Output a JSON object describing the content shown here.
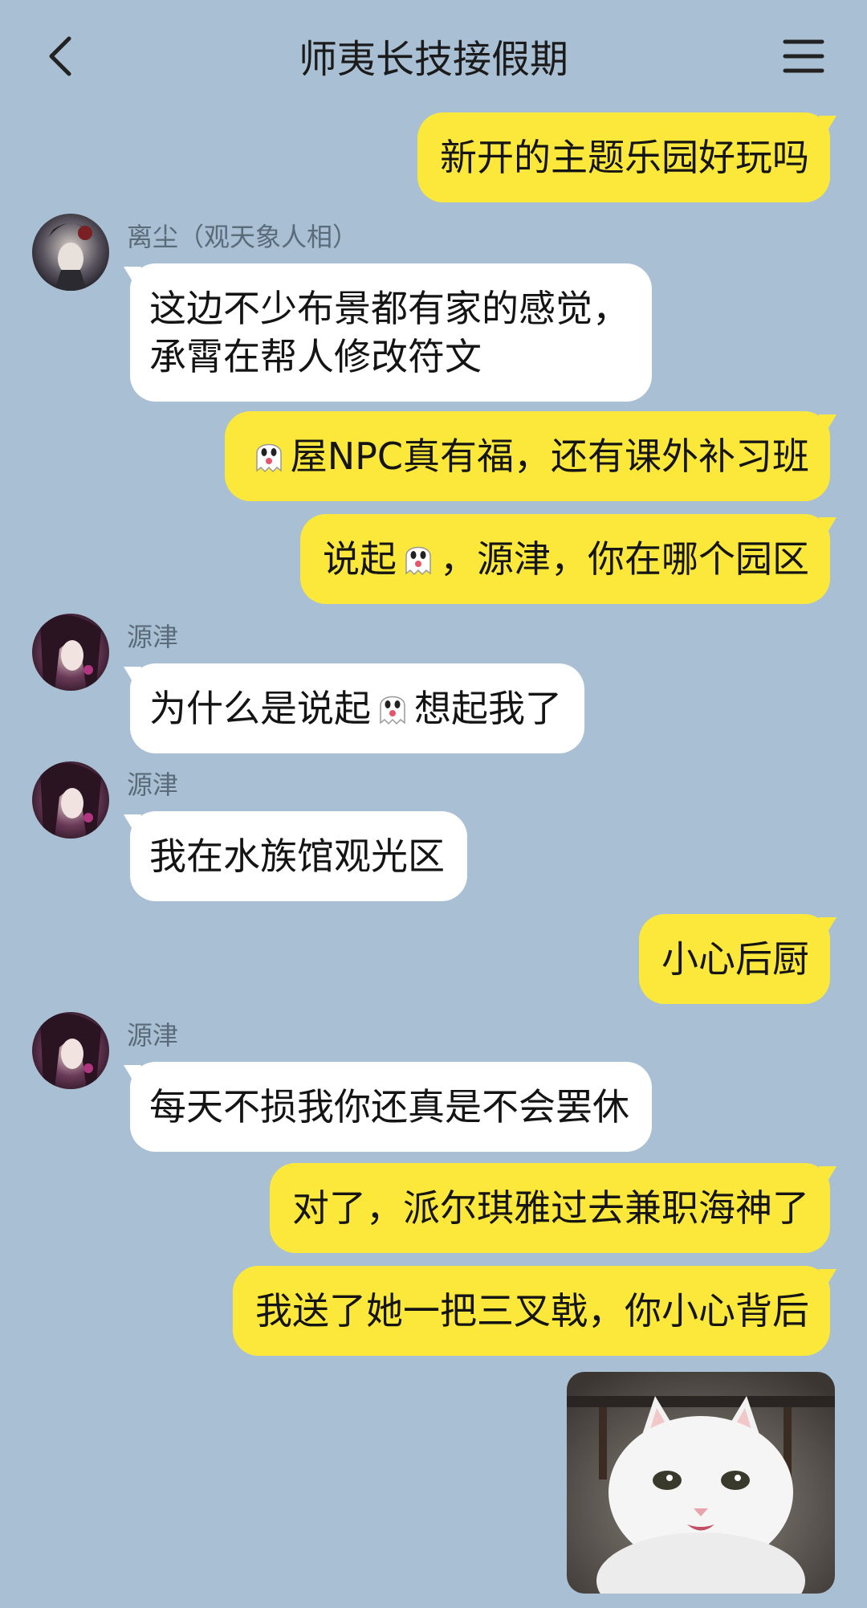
{
  "header": {
    "title": "师夷长技接假期",
    "back_icon": "chevron-left-icon",
    "menu_icon": "hamburger-menu-icon"
  },
  "colors": {
    "background": "#a9bfd3",
    "outgoing_bubble": "#fce83b",
    "incoming_bubble": "#ffffff"
  },
  "messages": [
    {
      "direction": "out",
      "text": "新开的主题乐园好玩吗"
    },
    {
      "direction": "in",
      "sender": "离尘（观天象人相）",
      "lines": [
        "这边不少布景都有家的感觉，",
        "承霄在帮人修改符文"
      ]
    },
    {
      "direction": "out",
      "parts": [
        "",
        "屋NPC真有福，还有课外补习班"
      ]
    },
    {
      "direction": "out",
      "parts": [
        "说起",
        "，源津，你在哪个园区"
      ]
    },
    {
      "direction": "in",
      "sender": "源津",
      "parts": [
        "为什么是说起",
        "想起我了"
      ]
    },
    {
      "direction": "in",
      "sender": "源津",
      "text": "我在水族馆观光区"
    },
    {
      "direction": "out",
      "text": "小心后厨"
    },
    {
      "direction": "in",
      "sender": "源津",
      "text": "每天不损我你还真是不会罢休"
    },
    {
      "direction": "out",
      "text": "对了，派尔琪雅过去兼职海神了"
    },
    {
      "direction": "out",
      "text": "我送了她一把三叉戟，你小心背后"
    },
    {
      "direction": "out",
      "type": "image",
      "image_icon": "cat-photo"
    }
  ],
  "emoji": "ghost-emoji-icon"
}
